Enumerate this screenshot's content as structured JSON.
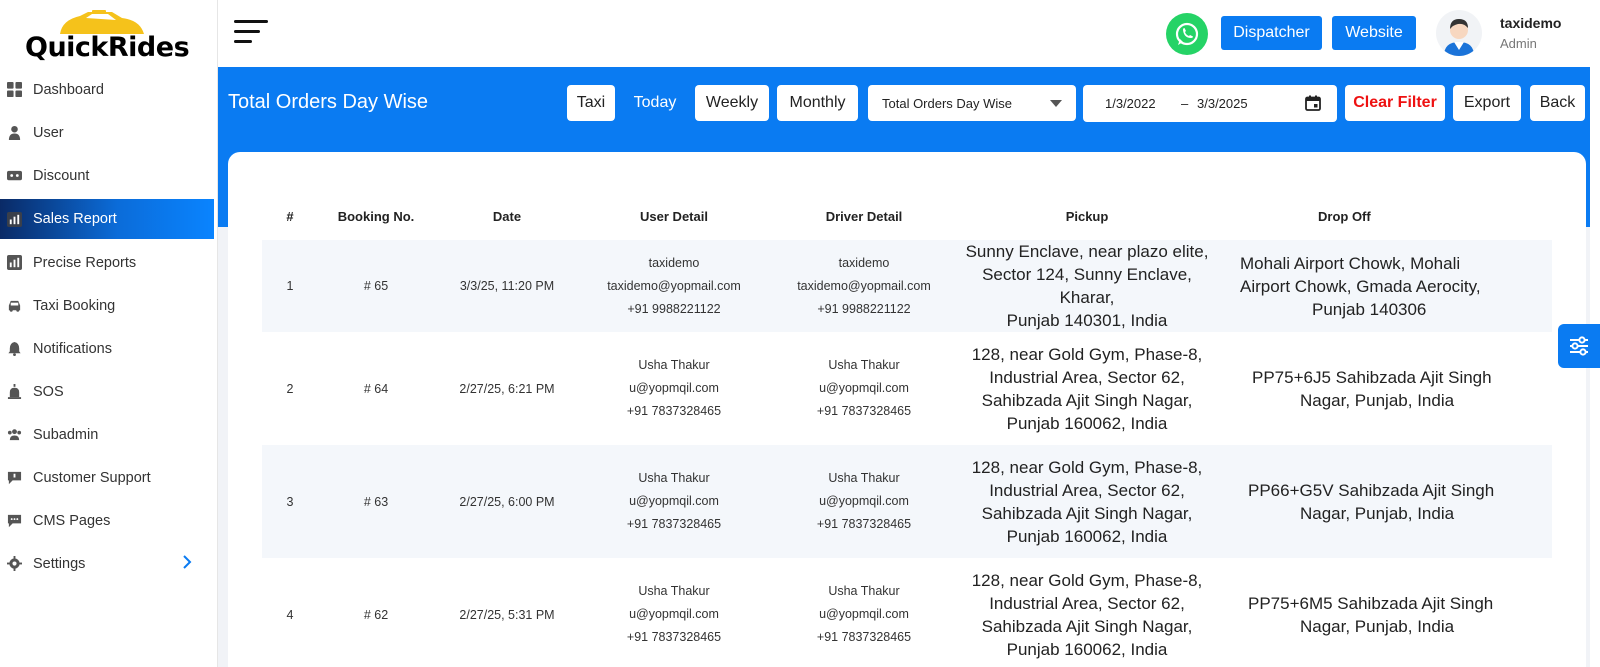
{
  "brand": {
    "name": "QuickRides"
  },
  "sidebar": {
    "items": [
      {
        "label": "Dashboard",
        "icon": "dashboard-icon"
      },
      {
        "label": "User",
        "icon": "user-icon"
      },
      {
        "label": "Discount",
        "icon": "discount-icon"
      },
      {
        "label": "Sales Report",
        "icon": "report-icon",
        "active": true
      },
      {
        "label": "Precise Reports",
        "icon": "chart-icon"
      },
      {
        "label": "Taxi Booking",
        "icon": "car-icon"
      },
      {
        "label": "Notifications",
        "icon": "bell-icon"
      },
      {
        "label": "SOS",
        "icon": "alarm-icon"
      },
      {
        "label": "Subadmin",
        "icon": "users-icon"
      },
      {
        "label": "Customer Support",
        "icon": "support-icon"
      },
      {
        "label": "CMS Pages",
        "icon": "cms-icon"
      },
      {
        "label": "Settings",
        "icon": "gear-icon"
      }
    ]
  },
  "topbar": {
    "dispatcher": "Dispatcher",
    "website": "Website",
    "user_name": "taxidemo",
    "user_role": "Admin"
  },
  "header": {
    "title": "Total Orders Day Wise",
    "taxi": "Taxi",
    "today": "Today",
    "weekly": "Weekly",
    "monthly": "Monthly",
    "select_value": "Total Orders Day Wise",
    "date_from": "1/3/2022",
    "date_sep": "–",
    "date_to": "3/3/2025",
    "clear": "Clear Filter",
    "export": "Export",
    "back": "Back"
  },
  "table": {
    "columns": [
      "#",
      "Booking No.",
      "Date",
      "User Detail",
      "Driver Detail",
      "Pickup",
      "Drop Off"
    ],
    "rows": [
      {
        "num": "1",
        "booking": "# 65",
        "date": "3/3/25, 11:20 PM",
        "user": [
          "taxidemo",
          "taxidemo@yopmail.com",
          "+91 9988221122"
        ],
        "driver": [
          "taxidemo",
          "taxidemo@yopmail.com",
          "+91 9988221122"
        ],
        "pickup": [
          "Sunny Enclave, near plazo elite,",
          "Sector 124, Sunny Enclave, Kharar,",
          "Punjab 140301, India"
        ],
        "drop": [
          "Mohali Airport Chowk, Mohali",
          "Airport Chowk, Gmada Aerocity,",
          "Punjab 140306"
        ]
      },
      {
        "num": "2",
        "booking": "# 64",
        "date": "2/27/25, 6:21 PM",
        "user": [
          "Usha Thakur",
          "u@yopmqil.com",
          "+91 7837328465"
        ],
        "driver": [
          "Usha Thakur",
          "u@yopmqil.com",
          "+91 7837328465"
        ],
        "pickup": [
          "128, near Gold Gym, Phase-8,",
          "Industrial Area, Sector 62,",
          "Sahibzada Ajit Singh Nagar,",
          "Punjab 160062, India"
        ],
        "drop": [
          "PP75+6J5 Sahibzada Ajit Singh",
          "Nagar, Punjab, India"
        ]
      },
      {
        "num": "3",
        "booking": "# 63",
        "date": "2/27/25, 6:00 PM",
        "user": [
          "Usha Thakur",
          "u@yopmqil.com",
          "+91 7837328465"
        ],
        "driver": [
          "Usha Thakur",
          "u@yopmqil.com",
          "+91 7837328465"
        ],
        "pickup": [
          "128, near Gold Gym, Phase-8,",
          "Industrial Area, Sector 62,",
          "Sahibzada Ajit Singh Nagar,",
          "Punjab 160062, India"
        ],
        "drop": [
          "PP66+G5V Sahibzada Ajit Singh",
          "Nagar, Punjab, India"
        ]
      },
      {
        "num": "4",
        "booking": "# 62",
        "date": "2/27/25, 5:31 PM",
        "user": [
          "Usha Thakur",
          "u@yopmqil.com",
          "+91 7837328465"
        ],
        "driver": [
          "Usha Thakur",
          "u@yopmqil.com",
          "+91 7837328465"
        ],
        "pickup": [
          "128, near Gold Gym, Phase-8,",
          "Industrial Area, Sector 62,",
          "Sahibzada Ajit Singh Nagar,",
          "Punjab 160062, India"
        ],
        "drop": [
          "PP75+6M5 Sahibzada Ajit Singh",
          "Nagar, Punjab, India"
        ]
      }
    ]
  },
  "colors": {
    "primary": "#0a7bf2",
    "danger": "#e11111",
    "whatsapp": "#25d366"
  }
}
